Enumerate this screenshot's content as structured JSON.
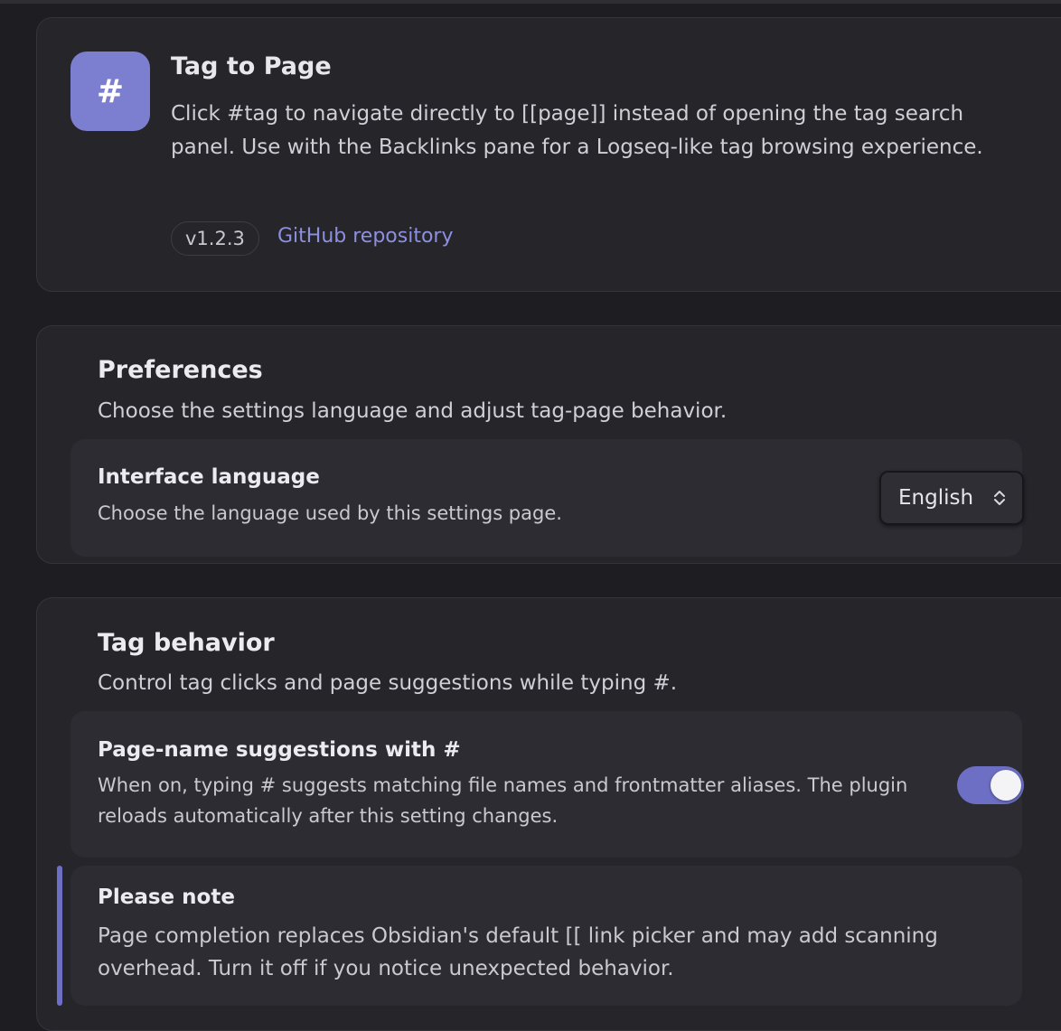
{
  "plugin": {
    "icon": "hash-icon",
    "icon_glyph": "#",
    "name": "Tag to Page",
    "description": "Click #tag to navigate directly to [[page]] instead of opening the tag search panel. Use with the Backlinks pane for a Logseq-like tag browsing experience.",
    "version": "v1.2.3",
    "repo_link_label": "GitHub repository"
  },
  "preferences": {
    "title": "Preferences",
    "description": "Choose the settings language and adjust tag-page behavior.",
    "language": {
      "name": "Interface language",
      "description": "Choose the language used by this settings page.",
      "selected": "English"
    }
  },
  "tag_behavior": {
    "title": "Tag behavior",
    "description": "Control tag clicks and page suggestions while typing #.",
    "suggestions": {
      "name": "Page-name suggestions with #",
      "description": "When on, typing # suggests matching file names and frontmatter aliases. The plugin reloads automatically after this setting changes.",
      "enabled": true
    },
    "note": {
      "title": "Please note",
      "body": "Page completion replaces Obsidian's default [[ link picker and may add scanning overhead. Turn it off if you notice unexpected behavior."
    }
  },
  "colors": {
    "accent": "#7c7fcf",
    "toggle_on": "#6c6fc4",
    "link": "#8d90e0",
    "background": "#1e1e22",
    "card": "#25252a"
  }
}
